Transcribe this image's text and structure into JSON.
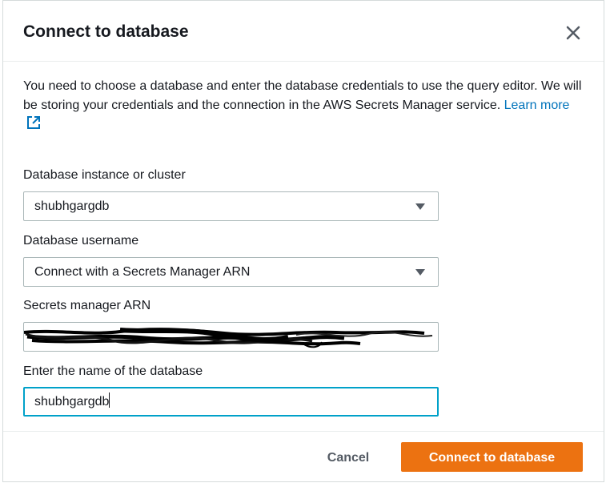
{
  "dialog": {
    "title": "Connect to database",
    "intro_text": "You need to choose a database and enter the database credentials to use the query editor. We will be storing your credentials and the connection in the AWS Secrets Manager service.",
    "learn_more": "Learn more"
  },
  "fields": {
    "instance": {
      "label": "Database instance or cluster",
      "value": "shubhgargdb"
    },
    "username": {
      "label": "Database username",
      "value": "Connect with a Secrets Manager ARN"
    },
    "secret_arn": {
      "label": "Secrets manager ARN"
    },
    "db_name": {
      "label": "Enter the name of the database",
      "value": "shubhgargdb"
    }
  },
  "footer": {
    "cancel_label": "Cancel",
    "connect_label": "Connect to database"
  },
  "colors": {
    "primary": "#ec7211",
    "link": "#0073bb",
    "focus": "#00a1c9"
  },
  "icons": {
    "close": "close-icon",
    "external": "external-link-icon",
    "dropdown": "caret-down-icon"
  }
}
